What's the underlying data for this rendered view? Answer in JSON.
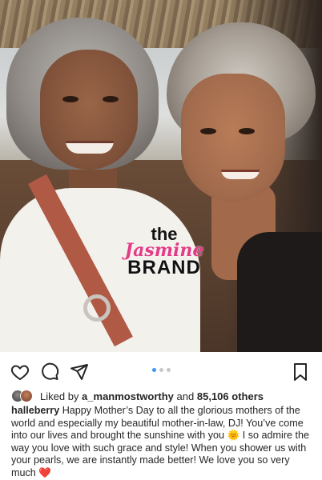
{
  "post": {
    "watermark": {
      "line1": "the",
      "line2": "Jasmine",
      "line3": "BRAND"
    },
    "carousel": {
      "total": 3,
      "active": 1
    },
    "icons": {
      "like": "heart-icon",
      "comment": "comment-icon",
      "share": "send-icon",
      "save": "bookmark-icon"
    },
    "likes": {
      "prefix": "Liked by",
      "user": "a_manmostworthy",
      "middle": "and",
      "count": "85,106 others"
    },
    "caption": {
      "username": "halleberry",
      "text_1": " Happy Mother’s Day to all the glorious mothers of the world and especially my beautiful mother-in-law, DJ! You’ve come into our lives and brought the sunshine with you ",
      "sun_emoji": "🌞",
      "text_2": " I so admire the way you love with such grace and style! When you shower us with your pearls, we are instantly made better! We love you so very much ",
      "heart_emoji": "❤️"
    }
  },
  "colors": {
    "carousel_active": "#3897f0",
    "carousel_inactive": "#c7c7c7",
    "watermark_pink": "#e23c86",
    "heart": "#e0245e"
  }
}
